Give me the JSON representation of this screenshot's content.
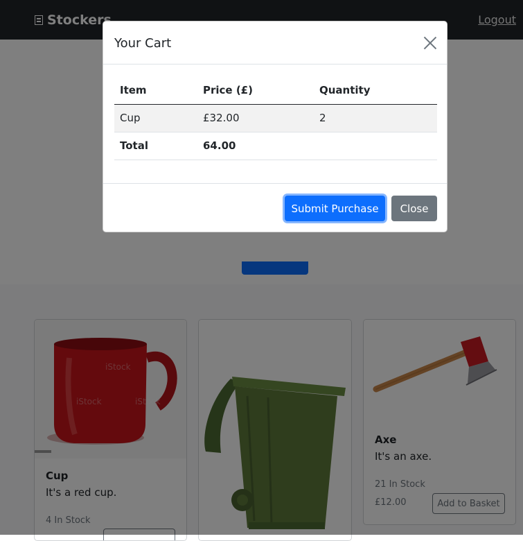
{
  "navbar": {
    "brand": "Stockers",
    "brand_icon": "document-icon",
    "logout_label": "Logout"
  },
  "products": [
    {
      "name": "Cup",
      "description": "It's a red cup.",
      "stock": "4 In Stock",
      "price": "",
      "button_label": ""
    },
    {
      "name": "",
      "description": "",
      "stock": "",
      "price": "",
      "button_label": ""
    },
    {
      "name": "Axe",
      "description": "It's an axe.",
      "stock": "21 In Stock",
      "price": "£12.00",
      "button_label": "Add to Basket"
    }
  ],
  "cart_modal": {
    "title": "Your Cart",
    "close_icon": "close-icon",
    "columns": [
      "Item",
      "Price (£)",
      "Quantity"
    ],
    "rows": [
      {
        "item": "Cup",
        "price": "£32.00",
        "quantity": "2"
      }
    ],
    "total_label": "Total",
    "total_value": "64.00",
    "submit_label": "Submit Purchase",
    "close_label": "Close"
  },
  "colors": {
    "navbar_bg": "#212529",
    "primary": "#0d6efd",
    "secondary": "#6c757d",
    "cup_red": "#c8141b",
    "bin_green": "#5e7a3a",
    "axe_red": "#c81a22",
    "axe_handle": "#c8874a"
  }
}
